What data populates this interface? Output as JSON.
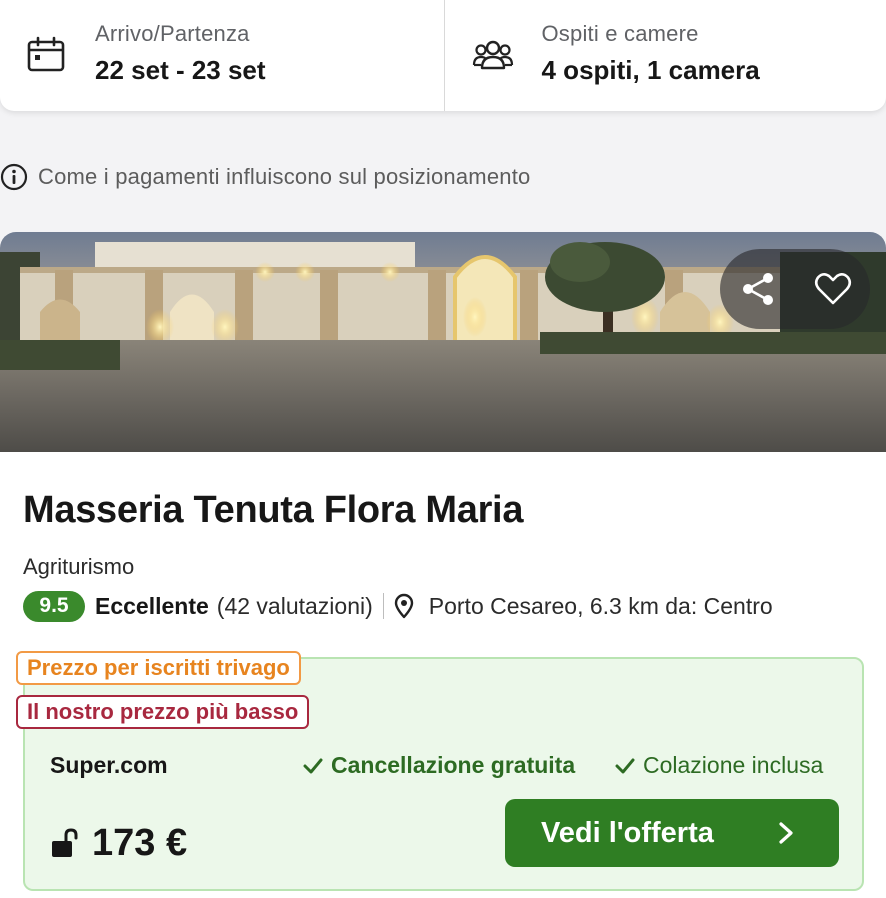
{
  "search": {
    "dates_label": "Arrivo/Partenza",
    "dates_value": "22 set - 23 set",
    "guests_label": "Ospiti e camere",
    "guests_value": "4 ospiti, 1 camera"
  },
  "info": {
    "payment_notice": "Come i pagamenti influiscono sul posizionamento"
  },
  "hotel": {
    "name": "Masseria Tenuta Flora Maria",
    "type": "Agriturismo",
    "score": "9.5",
    "rating_word": "Eccellente",
    "rating_count": "(42 valutazioni)",
    "location": "Porto Cesareo, 6.3 km da: Centro"
  },
  "offer": {
    "tag_member": "Prezzo per iscritti trivago",
    "tag_lowest": "Il nostro prezzo più basso",
    "provider": "Super.com",
    "feature_cancel": "Cancellazione gratuita",
    "feature_breakfast": "Colazione inclusa",
    "price": "173 €",
    "cta": "Vedi l'offerta"
  },
  "icons": {
    "calendar": "calendar-icon",
    "guests": "guests-icon",
    "info": "info-icon",
    "share": "share-icon",
    "favorite": "heart-icon",
    "location": "map-pin-icon",
    "check": "checkmark-icon",
    "lock": "unlocked-padlock-icon",
    "chevron": "chevron-right-icon"
  },
  "colors": {
    "score_badge": "#3a8a2c",
    "cta_button": "#2f7e23",
    "offer_bg": "#ecf8ea",
    "offer_border": "#b9e4b2",
    "tag_member": "#e7841f",
    "tag_lowest": "#a8283f",
    "feature_text": "#2d6b23"
  }
}
